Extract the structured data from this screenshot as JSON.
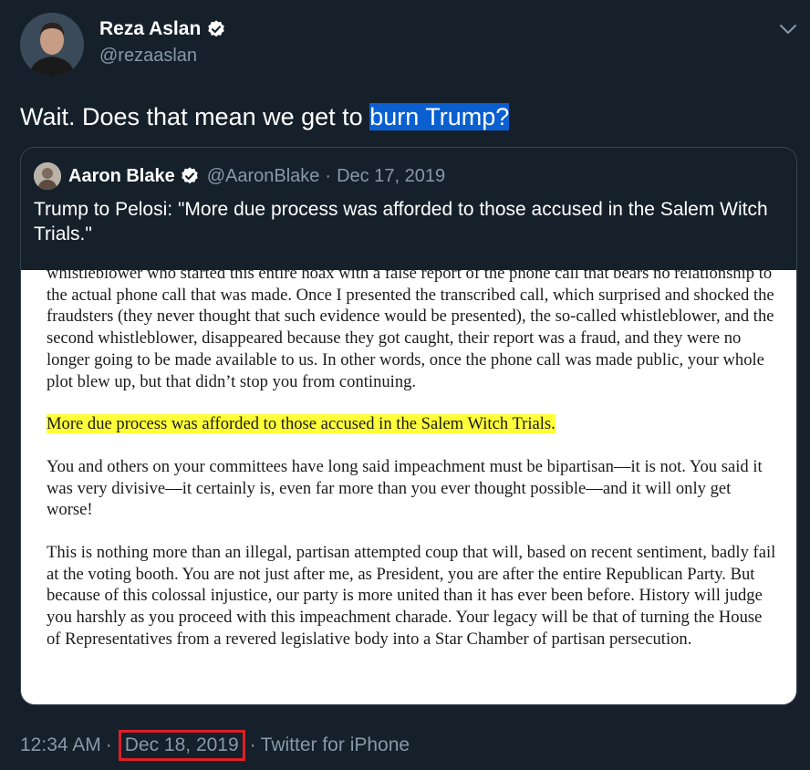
{
  "author": {
    "name": "Reza Aslan",
    "handle": "@rezaaslan"
  },
  "tweet": {
    "text_plain": "Wait. Does that mean we get to ",
    "text_highlight": "burn Trump?"
  },
  "quoted_tweet": {
    "name": "Aaron Blake",
    "handle": "@AaronBlake",
    "separator": "·",
    "date": "Dec 17, 2019",
    "text": "Trump to Pelosi: \"More due process was afforded to those accused in the Salem Witch Trials.\"",
    "image_doc": {
      "para1": "whistleblower who started this entire hoax with a false report of the phone call that bears no relationship to the actual phone call that was made.  Once I presented the transcribed call, which surprised and shocked the fraudsters (they never thought that such evidence would be presented), the so-called whistleblower, and the second whistleblower, disappeared because they got caught, their report was a fraud, and they were no longer going to be made available to us.  In other words, once the phone call was made public, your whole plot blew up, but that didn’t stop you from continuing.",
      "highlight": "More due process was afforded to those accused in the Salem Witch Trials.",
      "para2": "You and others on your committees have long said impeachment must be bipartisan—it is not. You said it was very divisive—it certainly is, even far more than you ever thought possible—and it will only get worse!",
      "para3": "This is nothing more than an illegal, partisan attempted coup that will, based on recent sentiment, badly fail at the voting booth.  You are not just after me, as President, you are after the entire Republican Party.  But because of this colossal injustice, our party is more united than it has ever been before.  History will judge you harshly as you proceed with this impeachment charade. Your legacy will be that of turning the House of Representatives from a revered legislative body into a Star Chamber of partisan persecution."
    }
  },
  "footer": {
    "time": "12:34 AM",
    "separator": "·",
    "date": "Dec 18, 2019",
    "source": "Twitter for iPhone"
  },
  "colors": {
    "background": "#15202b",
    "muted": "#8899a6",
    "highlight_blue": "#0a5fd1",
    "doc_highlight": "#ffff3a",
    "annotation_red": "#e01e25"
  },
  "icons": {
    "verified": "verified-badge-icon",
    "menu": "chevron-down-icon"
  }
}
